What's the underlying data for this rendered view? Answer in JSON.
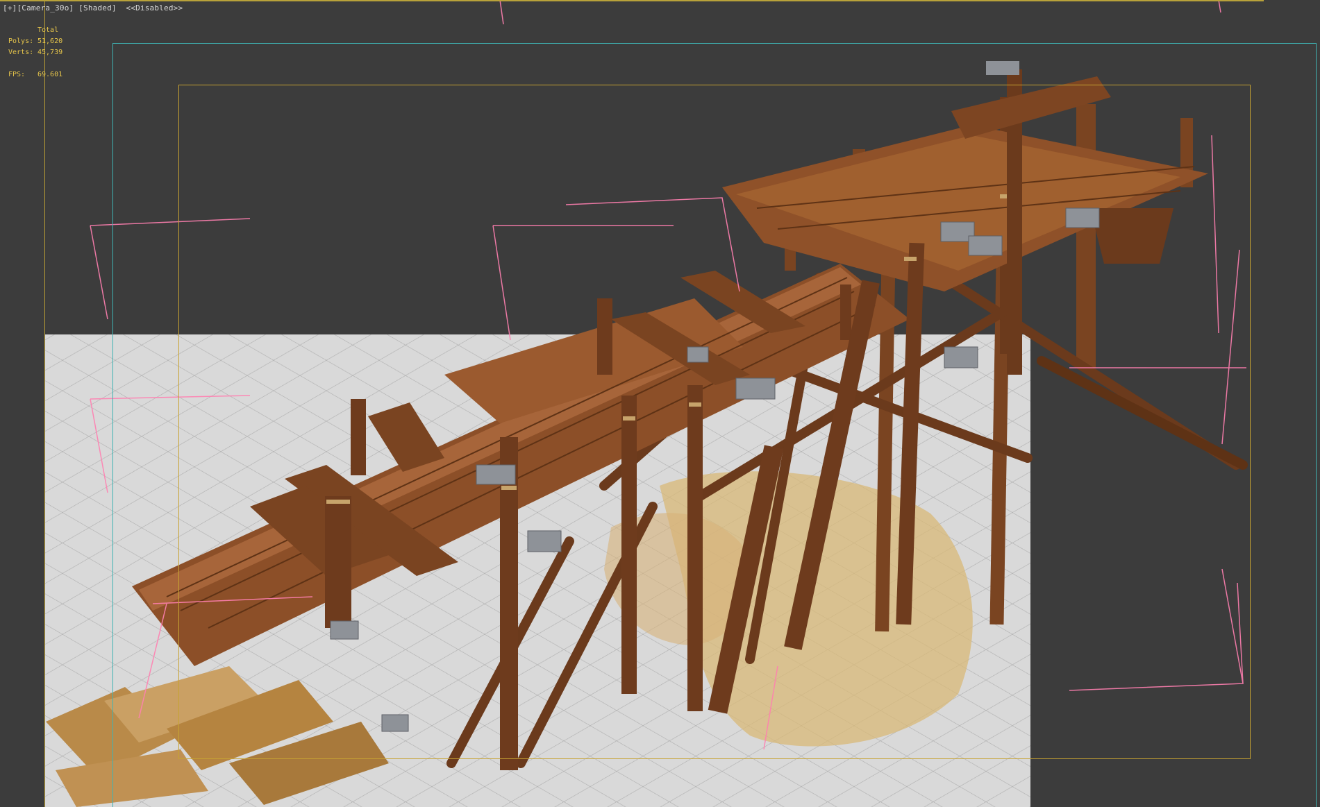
{
  "viewport": {
    "menu_plus": "[+]",
    "camera": "[Camera_30o]",
    "shading": "[Shaded]",
    "disabled": "<<Disabled>>"
  },
  "stats": {
    "header": "Total",
    "polys_label": "Polys:",
    "polys_value": "51,620",
    "verts_label": "Verts:",
    "verts_value": "45,739",
    "fps_label": "FPS:",
    "fps_value": "69.601"
  },
  "colors": {
    "viewport_bg": "#3c3c3c",
    "ground": "#d9d9d9",
    "safe_frame_outer": "#3fb3b3",
    "safe_frame_inner": "#c7a332",
    "stats_text": "#e7c64b",
    "wood_dark": "#6b3a1c",
    "wood_light": "#9a5a2e",
    "metal": "#8e9298",
    "helper_lines": "#ff7fb0",
    "shadow_sand": "#d8b877"
  }
}
